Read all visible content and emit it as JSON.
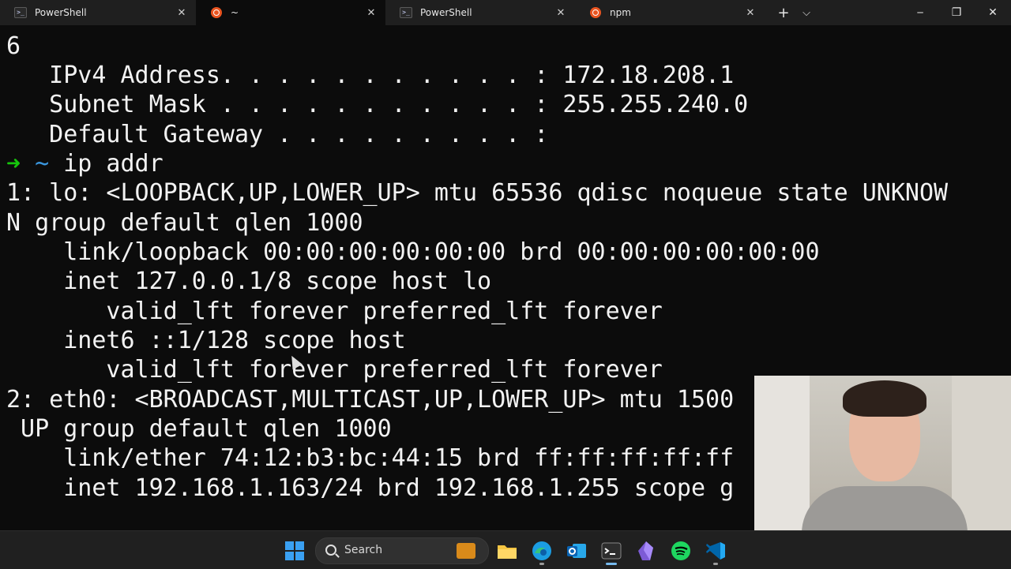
{
  "tabs": [
    {
      "label": "PowerShell",
      "icon": "powershell-icon",
      "active": false
    },
    {
      "label": "~",
      "icon": "ubuntu-icon",
      "active": true
    },
    {
      "label": "PowerShell",
      "icon": "powershell-icon",
      "active": false
    },
    {
      "label": "npm",
      "icon": "ubuntu-icon",
      "active": false
    }
  ],
  "tab_close_glyph": "✕",
  "controls": {
    "new_tab": "+",
    "dropdown": "⌵",
    "minimize": "─",
    "restore": "❐",
    "close": "✕"
  },
  "terminal": {
    "line0": "6",
    "line1": "   IPv4 Address. . . . . . . . . . . : 172.18.208.1",
    "line2": "   Subnet Mask . . . . . . . . . . . : 255.255.240.0",
    "line3": "   Default Gateway . . . . . . . . . :",
    "prompt_arrow": "➜",
    "prompt_dir": "~",
    "prompt_cmd": " ip addr",
    "line5": "1: lo: <LOOPBACK,UP,LOWER_UP> mtu 65536 qdisc noqueue state UNKNOW",
    "line6": "N group default qlen 1000",
    "line7": "    link/loopback 00:00:00:00:00:00 brd 00:00:00:00:00:00",
    "line8": "    inet 127.0.0.1/8 scope host lo",
    "line9": "       valid_lft forever preferred_lft forever",
    "line10": "    inet6 ::1/128 scope host",
    "line11": "       valid_lft forever preferred_lft forever",
    "line12": "2: eth0: <BROADCAST,MULTICAST,UP,LOWER_UP> mtu 1500",
    "line13": " UP group default qlen 1000",
    "line14": "    link/ether 74:12:b3:bc:44:15 brd ff:ff:ff:ff:ff",
    "line15": "    inet 192.168.1.163/24 brd 192.168.1.255 scope g"
  },
  "taskbar": {
    "search_label": "Search",
    "apps": [
      "start-icon",
      "file-explorer-icon",
      "edge-icon",
      "outlook-icon",
      "terminal-icon",
      "obsidian-icon",
      "spotify-icon",
      "vscode-icon"
    ]
  },
  "colors": {
    "terminal_bg": "#0c0c0c",
    "tabbar_bg": "#1f1f1f",
    "prompt_arrow": "#16c60c",
    "prompt_dir": "#3a96dd",
    "ubuntu": "#e95420",
    "taskbar_bg": "#202020"
  }
}
